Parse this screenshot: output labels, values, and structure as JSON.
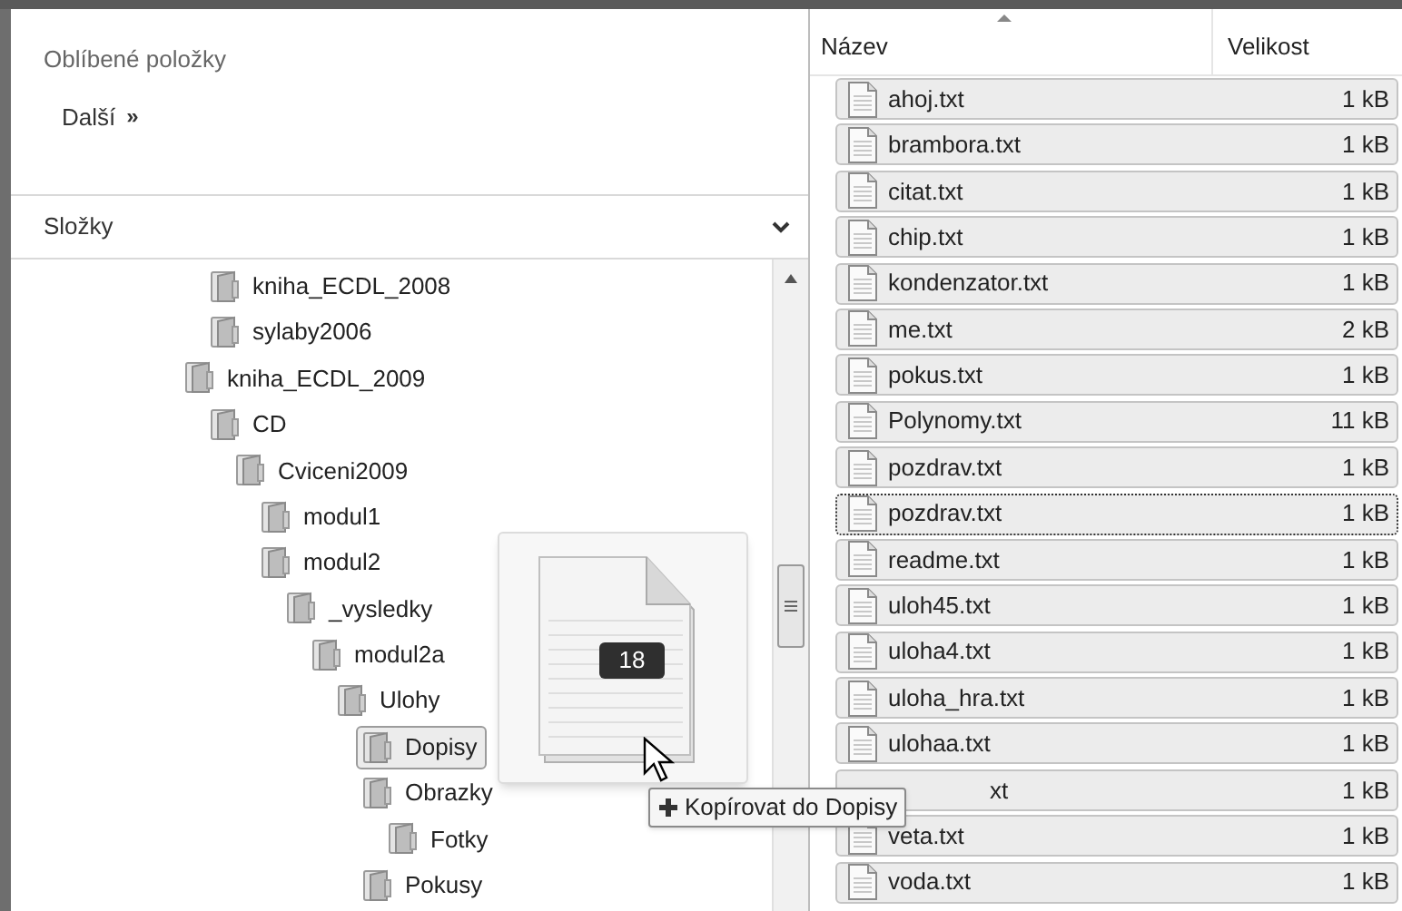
{
  "favorites": {
    "title": "Oblíbené položky",
    "more": "Další",
    "more_icon": "»"
  },
  "folders": {
    "title": "Složky"
  },
  "tree": [
    {
      "children": [
        {
          "label": "kniha_ECDL_2008",
          "selected": false
        },
        {
          "label": "sylaby2006",
          "selected": false
        }
      ]
    },
    {
      "label": "kniha_ECDL_2009",
      "selected": false,
      "children": [
        {
          "label": "CD",
          "selected": false,
          "children": [
            {
              "label": "Cviceni2009",
              "selected": false,
              "children": [
                {
                  "label": "modul1",
                  "selected": false
                },
                {
                  "label": "modul2",
                  "selected": false,
                  "children": [
                    {
                      "label": "_vysledky",
                      "selected": false,
                      "children": [
                        {
                          "label": "modul2a",
                          "selected": false,
                          "children": [
                            {
                              "label": "Ulohy",
                              "selected": false,
                              "children": [
                                {
                                  "label": "Dopisy",
                                  "selected": true
                                },
                                {
                                  "label": "Obrazky",
                                  "selected": false,
                                  "children": [
                                    {
                                      "label": "Fotky",
                                      "selected": false
                                    }
                                  ]
                                },
                                {
                                  "label": "Pokusy",
                                  "selected": false
                                }
                              ]
                            }
                          ]
                        }
                      ]
                    }
                  ]
                }
              ]
            }
          ]
        }
      ]
    }
  ],
  "files": {
    "columns": [
      "Název",
      "Velikost"
    ],
    "rows": [
      {
        "name": "ahoj.txt",
        "size": "1 kB",
        "selected": true,
        "focused": false
      },
      {
        "name": "brambora.txt",
        "size": "1 kB",
        "selected": true,
        "focused": false
      },
      {
        "name": "citat.txt",
        "size": "1 kB",
        "selected": true,
        "focused": false
      },
      {
        "name": "chip.txt",
        "size": "1 kB",
        "selected": true,
        "focused": false
      },
      {
        "name": "kondenzator.txt",
        "size": "1 kB",
        "selected": true,
        "focused": false
      },
      {
        "name": "me.txt",
        "size": "2 kB",
        "selected": true,
        "focused": false
      },
      {
        "name": "pokus.txt",
        "size": "1 kB",
        "selected": true,
        "focused": false
      },
      {
        "name": "Polynomy.txt",
        "size": "11 kB",
        "selected": true,
        "focused": false
      },
      {
        "name": "pozdrav.txt",
        "size": "1 kB",
        "selected": true,
        "focused": false
      },
      {
        "name": "pozdrav.txt",
        "size": "1 kB",
        "selected": true,
        "focused": true
      },
      {
        "name": "readme.txt",
        "size": "1 kB",
        "selected": true,
        "focused": false
      },
      {
        "name": "uloh45.txt",
        "size": "1 kB",
        "selected": true,
        "focused": false
      },
      {
        "name": "uloha4.txt",
        "size": "1 kB",
        "selected": true,
        "focused": false
      },
      {
        "name": "uloha_hra.txt",
        "size": "1 kB",
        "selected": true,
        "focused": false
      },
      {
        "name": "ulohaa.txt",
        "size": "1 kB",
        "selected": true,
        "focused": false
      },
      {
        "name": "xt",
        "size": "1 kB",
        "selected": true,
        "focused": false,
        "covered": true
      },
      {
        "name": "veta.txt",
        "size": "1 kB",
        "selected": true,
        "focused": false
      },
      {
        "name": "voda.txt",
        "size": "1 kB",
        "selected": true,
        "focused": false
      }
    ]
  },
  "drag": {
    "count": "18"
  },
  "tooltip": {
    "text": "Kopírovat do Dopisy"
  }
}
